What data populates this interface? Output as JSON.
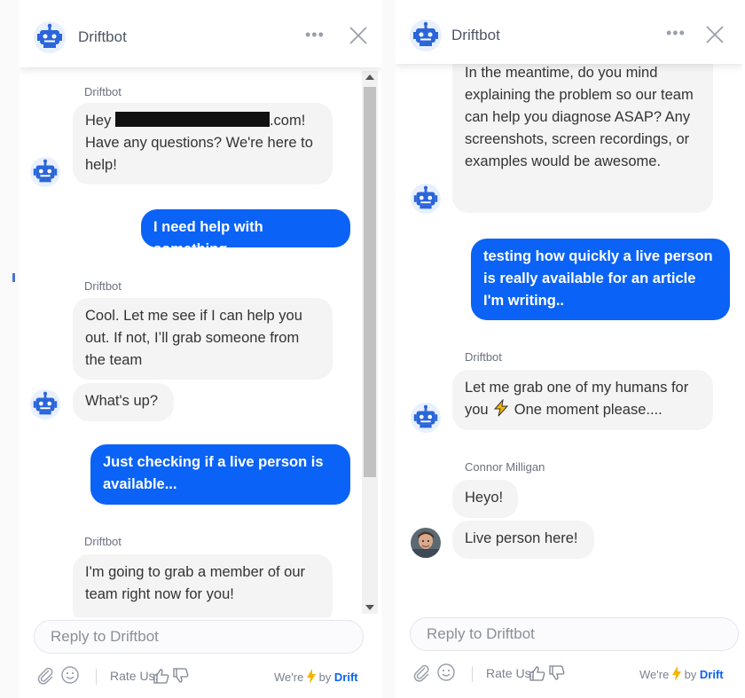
{
  "left": {
    "header": {
      "bot_name": "Driftbot"
    },
    "messages": {
      "n1": "Driftbot",
      "b1_pre": "Hey ",
      "b1_post": ".com!",
      "b1_rest": "Have any questions? We're here to help!",
      "u1": "I need help with something",
      "n2": "Driftbot",
      "b2": "Cool. Let me see if I can help you out. If not, I’ll grab someone from the team",
      "b3": "What's up?",
      "u2": "Just checking if a live person is available...",
      "n3": "Driftbot",
      "b4": "I'm going to grab a member of our team right now for you!"
    },
    "composer": {
      "placeholder": "Reply to Driftbot"
    },
    "footer": {
      "rate": "Rate Us:",
      "were": "We're",
      "by": "by",
      "brand": "Drift"
    }
  },
  "right": {
    "header": {
      "bot_name": "Driftbot"
    },
    "messages": {
      "b1": "In the meantime, do you mind explaining the problem so our team can help you diagnose ASAP? Any screenshots, screen recordings, or examples would be awesome.",
      "u1": "testing how quickly a live person is really available for an article I'm writing..",
      "n1": "Driftbot",
      "b2a": "Let me grab one of my humans for you",
      "b2b": "One moment please....",
      "n2": "Connor Milligan",
      "h1": "Heyo!",
      "h2": "Live person here!"
    },
    "composer": {
      "placeholder": "Reply to Driftbot"
    },
    "footer": {
      "rate": "Rate Us:",
      "were": "We're",
      "by": "by",
      "brand": "Drift"
    }
  },
  "colors": {
    "accent": "#0a63f6",
    "bubble": "#f4f4f5",
    "bolt": "#f5b400"
  },
  "icons": [
    "driftbot-avatar-icon",
    "more-dots-icon",
    "close-icon",
    "paperclip-icon",
    "emoji-icon",
    "thumbs-up-icon",
    "thumbs-down-icon",
    "lightning-icon",
    "user-avatar"
  ]
}
